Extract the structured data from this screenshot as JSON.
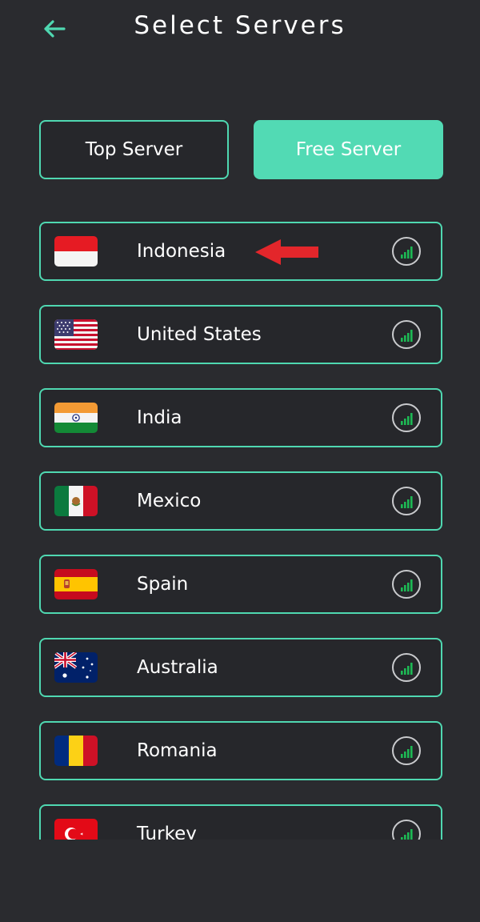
{
  "header": {
    "title": "Select Servers",
    "back_icon": "arrow-left-icon",
    "accent": "#4fd8b1"
  },
  "tabs": [
    {
      "label": "Top Server",
      "active": false
    },
    {
      "label": "Free Server",
      "active": true
    }
  ],
  "servers": [
    {
      "country": "Indonesia",
      "flag_icon": "flag-indonesia-icon"
    },
    {
      "country": "United States",
      "flag_icon": "flag-united-states-icon"
    },
    {
      "country": "India",
      "flag_icon": "flag-india-icon"
    },
    {
      "country": "Mexico",
      "flag_icon": "flag-mexico-icon"
    },
    {
      "country": "Spain",
      "flag_icon": "flag-spain-icon"
    },
    {
      "country": "Australia",
      "flag_icon": "flag-australia-icon"
    },
    {
      "country": "Romania",
      "flag_icon": "flag-romania-icon"
    },
    {
      "country": "Turkey",
      "flag_icon": "flag-turkey-icon"
    }
  ],
  "signal_icon": "signal-strength-icon",
  "annotation": {
    "icon": "red-arrow-icon",
    "color": "#e3262b"
  },
  "colors": {
    "background": "#2a2b2f",
    "row_bg": "#26272b",
    "border": "#4fd8b1",
    "active_tab": "#52dab4",
    "signal": "#1db954"
  }
}
